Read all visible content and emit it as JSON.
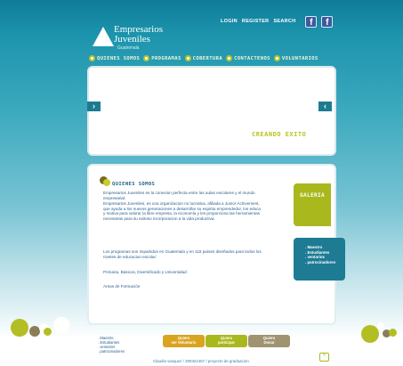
{
  "brand": {
    "name_line1": "Empresarios",
    "name_line2": "Juveniles",
    "sub": "Guatemala"
  },
  "topnav": {
    "login": "LOGIN",
    "register": "REGISTER",
    "search": "SEARCH",
    "fb1": "f",
    "fb2": "f"
  },
  "mainnav": [
    {
      "label": "QUIENES SOMOS"
    },
    {
      "label": "PROGRAMAS"
    },
    {
      "label": "COBERTURA"
    },
    {
      "label": "CONTACTENOS"
    },
    {
      "label": "VOLUNTARIOS"
    }
  ],
  "banner": {
    "left_arrow": "›",
    "right_arrow": "‹",
    "tagline": "CREANDO EXITO"
  },
  "content": {
    "title": "QUIENES SOMOS",
    "p1": "Empresarios Juveniles es la conexion perfecta entre las aulas escolares y el mundo empresarial.",
    "p2": "Empresarios Juveniles, es una organizacion no lucrativa, afiliada a Junior Achivement, que ayuda a los nuevos generaciones a desarrollar su espiritu emprendedor, los educa y motiva para valorar la libre empresa, la economía y les proporciona las herramientas necesarias para su exitoso incorporacion a la vida productiva.",
    "p3": "Los programas son impartidos en Guatemala y en 118 países diseñados para todos los niveles de educacion escolar:",
    "p4": "Primaria, Básicos, Diversificado y Universidad",
    "p5": "Areas de Formación"
  },
  "sidebar": {
    "galeria": "GALERIA",
    "links": [
      ". Maestro",
      ". Estudiantes",
      ". ventarios",
      ". patrocinadores"
    ]
  },
  "footer": {
    "links": [
      ". Maestro",
      ". Estudiantes",
      ". ventarios",
      ". patrocinadores"
    ],
    "btn1": [
      "Quiero",
      "ser Voluntario"
    ],
    "btn2": [
      "Quiero",
      "participar"
    ],
    "btn3": [
      "Quiero",
      "Donar"
    ],
    "credit": "Claudia vasquez / 200321467 / proyecto de graduacion",
    "up": "^"
  },
  "colors": {
    "accent": "#a9b81d",
    "brand_blue": "#1d7b94",
    "fb": "#3b5ba0"
  }
}
